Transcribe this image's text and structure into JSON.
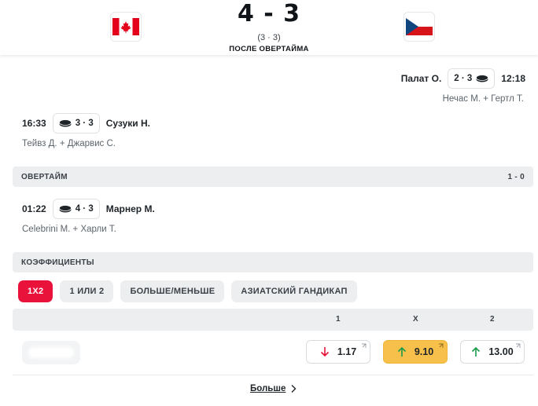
{
  "match": {
    "home_flag": "canada-flag-icon",
    "away_flag": "czech-flag-icon",
    "score": "4 - 3",
    "period_score": "(3 · 3)",
    "status": "ПОСЛЕ ОВЕРТАЙМА"
  },
  "events": [
    {
      "side": "away",
      "player": "Палат О.",
      "score": "2 · 3",
      "time": "12:18",
      "assist": "Нечас М. + Гертл Т."
    },
    {
      "side": "home",
      "time": "16:33",
      "score": "3 · 3",
      "player": "Сузуки Н.",
      "assist": "Тейвз Д. + Джарвис С."
    }
  ],
  "overtime": {
    "title": "ОВЕРТАЙМ",
    "score": "1 - 0",
    "event": {
      "side": "home",
      "time": "01:22",
      "score": "4 · 3",
      "player": "Марнер М.",
      "assist": "Celebrini M. + Харли Т."
    }
  },
  "odds": {
    "title": "КОЭФФИЦИЕНТЫ",
    "tabs": [
      "1X2",
      "1 ИЛИ 2",
      "БОЛЬШЕ/МЕНЬШЕ",
      "АЗИАТСКИЙ ГАНДИКАП"
    ],
    "active_tab": "1X2",
    "columns": [
      "1",
      "X",
      "2"
    ],
    "values": [
      {
        "value": "1.17",
        "trend": "down",
        "highlight": false
      },
      {
        "value": "9.10",
        "trend": "up",
        "highlight": true
      },
      {
        "value": "13.00",
        "trend": "up",
        "highlight": false
      }
    ],
    "colors": {
      "down": "#e8123b",
      "up": "#1a9a4a",
      "highlight": "#f7c04a",
      "accent": "#e8123b"
    }
  },
  "more_label": "Больше"
}
